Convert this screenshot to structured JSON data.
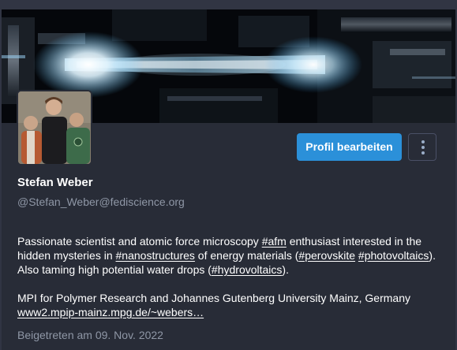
{
  "profile": {
    "display_name": "Stefan Weber",
    "handle": "@Stefan_Weber@fediscience.org",
    "edit_button_label": "Profil bearbeiten",
    "more_icon": "vertical-ellipsis-icon",
    "bio": {
      "line1": {
        "t1": "Passionate scientist and atomic force microscopy ",
        "h_afm": "#afm",
        "t2": " enthusiast interested in the hidden mysteries in ",
        "h_nano": "#nanostructures",
        "t3": " of energy materials (",
        "h_perov": "#perovskite",
        "t4": " ",
        "h_photo": "#photovoltaics",
        "t5": "). Also taming high potential water drops (",
        "h_hydro": "#hydrovoltaics",
        "t6": ")."
      },
      "line2": {
        "affiliation": "MPI for Polymer Research and Johannes Gutenberg University Mainz, Germany",
        "link": "www2.mpip-mainz.mpg.de/~webers…"
      }
    },
    "joined": "Beigetreten am 09. Nov. 2022"
  },
  "colors": {
    "background": "#282c37",
    "accent": "#2b90d9",
    "muted_text": "#8f97a6"
  }
}
